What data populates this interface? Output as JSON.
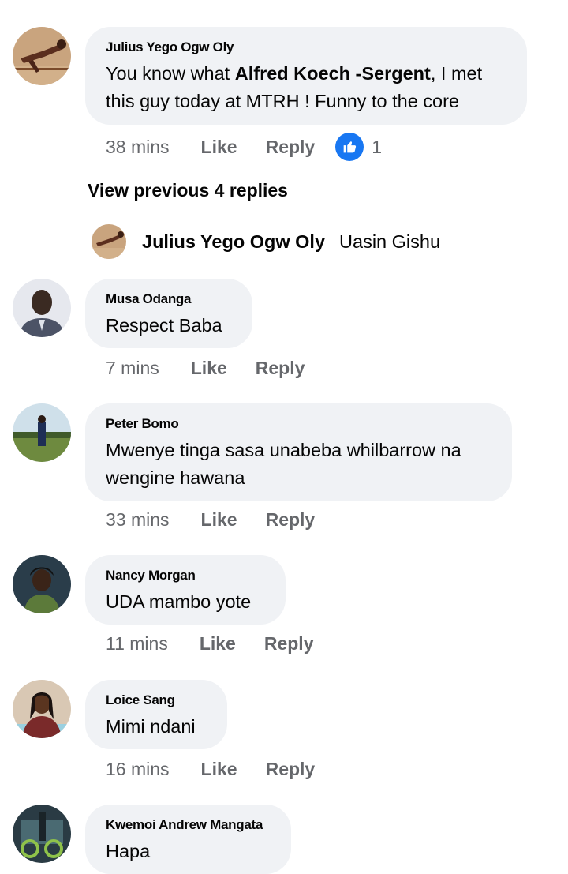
{
  "comments": [
    {
      "author": "Julius Yego Ogw Oly",
      "text_before": "You know what ",
      "mention": "Alfred Koech -Sergent",
      "text_after": ", I met this guy today at MTRH ! Funny to the core",
      "time": "38 mins",
      "like_label": "Like",
      "reply_label": "Reply",
      "reactions": "1",
      "avatar_icon": "profile-photo-runner"
    },
    {
      "author": "Musa Odanga",
      "text": "Respect Baba",
      "time": "7 mins",
      "like_label": "Like",
      "reply_label": "Reply",
      "avatar_icon": "profile-photo-man-suit"
    },
    {
      "author": "Peter Bomo",
      "text": "Mwenye tinga sasa unabeba whilbarrow na wengine hawana",
      "time": "33 mins",
      "like_label": "Like",
      "reply_label": "Reply",
      "avatar_icon": "profile-photo-field"
    },
    {
      "author": "Nancy Morgan",
      "text": "UDA mambo yote",
      "time": "11 mins",
      "like_label": "Like",
      "reply_label": "Reply",
      "avatar_icon": "profile-photo-woman"
    },
    {
      "author": "Loice Sang",
      "text": "Mimi ndani",
      "time": "16 mins",
      "like_label": "Like",
      "reply_label": "Reply",
      "avatar_icon": "profile-photo-woman-smiling"
    },
    {
      "author": "Kwemoi Andrew Mangata",
      "text": "Hapa",
      "avatar_icon": "profile-photo-bike"
    }
  ],
  "view_previous": "View previous 4 replies",
  "reply_preview": {
    "author": "Julius Yego Ogw Oly",
    "text": "Uasin Gishu"
  },
  "colors": {
    "bubble": "#f0f2f5",
    "meta": "#65676b",
    "like_blue": "#1877f2"
  }
}
